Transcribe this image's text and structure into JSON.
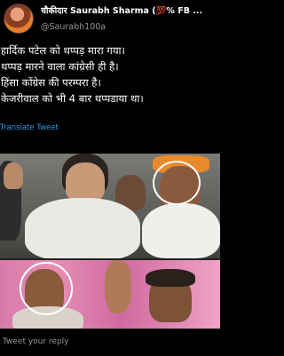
{
  "header": {
    "display_name": "चौकीदार Saurabh Sharma (💯% FB ...",
    "handle": "@Saurabh100a"
  },
  "tweet": {
    "lines": [
      "हार्दिक पटेल को थप्पड़ मारा गया।",
      "थप्पड़ मारने वाला कांग्रेसी ही है।",
      "हिंसा कोंग्रेस की परम्परा है।",
      "केजरीवाल को भी 4 बार थप्पडाया था।"
    ],
    "translate_label": "Translate Tweet"
  },
  "reply": {
    "placeholder": "Tweet your reply"
  },
  "colors": {
    "background": "#000000",
    "link": "#1da1f2",
    "muted": "#8e969d"
  }
}
